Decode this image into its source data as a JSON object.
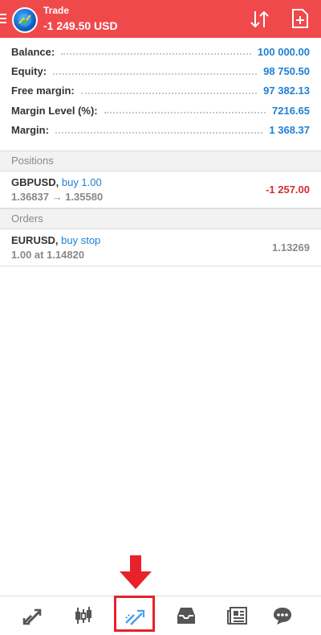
{
  "header": {
    "title": "Trade",
    "balance": "-1 249.50 USD",
    "bg_color": "#f0494c"
  },
  "summary": {
    "rows": [
      {
        "label": "Balance:",
        "value": "100 000.00"
      },
      {
        "label": "Equity:",
        "value": "98 750.50"
      },
      {
        "label": "Free margin:",
        "value": "97 382.13"
      },
      {
        "label": "Margin Level (%):",
        "value": "7216.65"
      },
      {
        "label": "Margin:",
        "value": "1 368.37"
      }
    ]
  },
  "positions": {
    "header": "Positions",
    "items": [
      {
        "symbol": "GBPUSD,",
        "side": "buy 1.00",
        "detail": "1.36837 → 1.35580",
        "amount": "-1 257.00"
      }
    ]
  },
  "orders": {
    "header": "Orders",
    "items": [
      {
        "symbol": "EURUSD,",
        "side": "buy stop",
        "detail": "1.00 at 1.14820",
        "amount": "1.13269"
      }
    ]
  },
  "nav": {
    "items": [
      {
        "icon": "quotes-icon"
      },
      {
        "icon": "chart-icon"
      },
      {
        "icon": "trade-icon",
        "active": true
      },
      {
        "icon": "inbox-icon"
      },
      {
        "icon": "news-icon"
      },
      {
        "icon": "chat-icon"
      }
    ]
  },
  "colors": {
    "accent": "#1e7fd6",
    "loss": "#d32f2f",
    "annotation": "#e8212a"
  }
}
